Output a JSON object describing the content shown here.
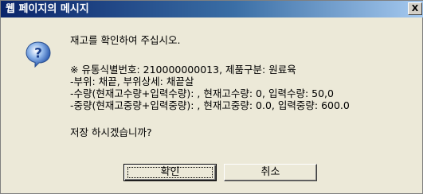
{
  "dialog": {
    "title": "웹 페이지의 메시지",
    "close_label": "X"
  },
  "message": {
    "line1": "재고를 확인하여 주십시오.",
    "line2": "※ 유통식별번호: 210000000013, 제품구분: 원료육",
    "line3": "-부위: 채끝, 부위상세: 채끝살",
    "line4": "-수량(현재고수량+입력수량): , 현재고수량: 0, 입력수량: 50,0",
    "line5": "-중량(현재고중량+입력중량): , 현재고중량: 0.0, 입력중량: 600.0",
    "line6": "저장 하시겠습니까?"
  },
  "buttons": {
    "ok_label": "확인",
    "cancel_label": "취소"
  },
  "icon": "question-icon"
}
